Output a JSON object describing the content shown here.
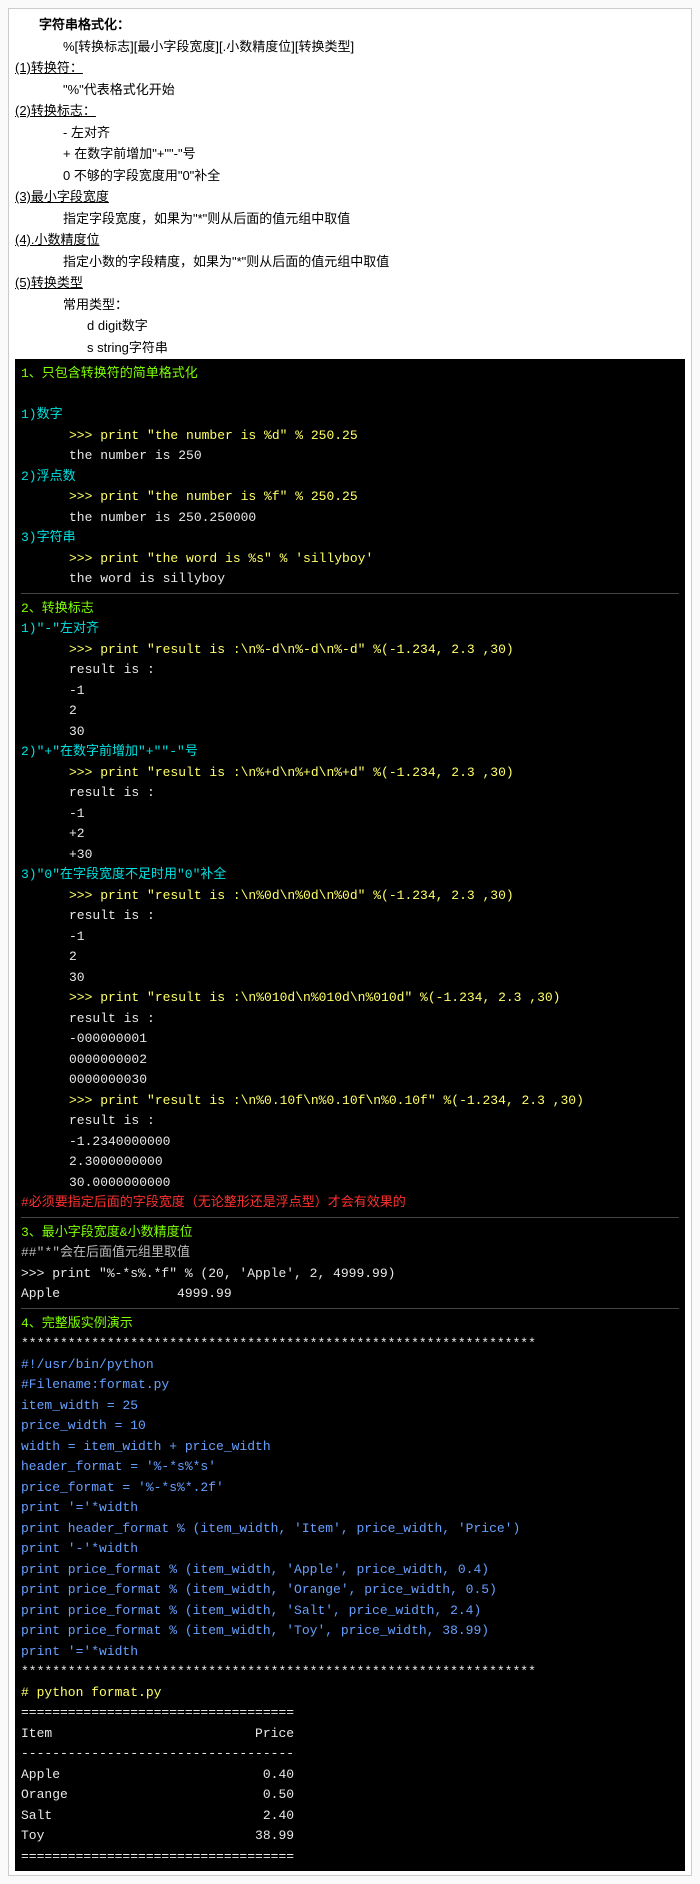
{
  "header": {
    "title": "字符串格式化：",
    "format_syntax": "%[转换标志][最小字段宽度][.小数精度位][转换类型]",
    "s1_title": "(1)转换符：",
    "s1_line1": "\"%\"代表格式化开始",
    "s2_title": "(2)转换标志：",
    "s2_line1": "- 左对齐",
    "s2_line2": "+ 在数字前增加\"+\"\"-\"号",
    "s2_line3": "0 不够的字段宽度用\"0\"补全",
    "s3_title": "(3)最小字段宽度",
    "s3_line1": "指定字段宽度，如果为\"*\"则从后面的值元组中取值",
    "s4_title": "(4).小数精度位",
    "s4_line1": "指定小数的字段精度，如果为\"*\"则从后面的值元组中取值",
    "s5_title": "(5)转换类型",
    "s5_line1": "常用类型：",
    "s5_line2": "d digit数字",
    "s5_line3": "s string字符串"
  },
  "block1": {
    "title": "1、只包含转换符的简单格式化",
    "sub1": "1)数字",
    "sub1_cmd": ">>> print \"the number is %d\" % 250.25",
    "sub1_out": "the number is 250",
    "sub2": "2)浮点数",
    "sub2_cmd": ">>> print \"the number is %f\" % 250.25",
    "sub2_out": "the number is 250.250000",
    "sub3": "3)字符串",
    "sub3_cmd": ">>> print \"the word is %s\" % 'sillyboy'",
    "sub3_out": "the word is sillyboy"
  },
  "block2": {
    "title": "2、转换标志",
    "sub1": "1)\"-\"左对齐",
    "sub1_cmd": ">>> print \"result is :\\n%-d\\n%-d\\n%-d\" %(-1.234, 2.3 ,30)",
    "sub1_out1": "result is :",
    "sub1_out2": "-1",
    "sub1_out3": "2",
    "sub1_out4": "30",
    "sub2": "2)\"+\"在数字前增加\"+\"\"-\"号",
    "sub2_cmd": ">>> print \"result is :\\n%+d\\n%+d\\n%+d\" %(-1.234, 2.3 ,30)",
    "sub2_out1": "result is :",
    "sub2_out2": "-1",
    "sub2_out3": "+2",
    "sub2_out4": "+30",
    "sub3": "3)\"0\"在字段宽度不足时用\"0\"补全",
    "sub3_cmd1": ">>> print \"result is :\\n%0d\\n%0d\\n%0d\" %(-1.234, 2.3 ,30)",
    "sub3_out1": "result is :",
    "sub3_out2": "-1",
    "sub3_out3": "2",
    "sub3_out4": "30",
    "sub3_cmd2": ">>> print \"result is :\\n%010d\\n%010d\\n%010d\" %(-1.234, 2.3 ,30)",
    "sub3_out5": "result is :",
    "sub3_out6": "-000000001",
    "sub3_out7": "0000000002",
    "sub3_out8": "0000000030",
    "sub3_cmd3": ">>> print \"result is :\\n%0.10f\\n%0.10f\\n%0.10f\" %(-1.234, 2.3 ,30)",
    "sub3_out9": "result is :",
    "sub3_out10": "-1.2340000000",
    "sub3_out11": "2.3000000000",
    "sub3_out12": "30.0000000000",
    "warning": "#必须要指定后面的字段宽度（无论整形还是浮点型）才会有效果的"
  },
  "block3": {
    "title": "3、最小字段宽度&小数精度位",
    "note": "##\"*\"会在后面值元组里取值",
    "cmd": ">>> print \"%-*s%.*f\" % (20, 'Apple', 2, 4999.99)",
    "out": "Apple               4999.99"
  },
  "block4": {
    "title": "4、完整版实例演示",
    "divider": "******************************************************************",
    "c1": "#!/usr/bin/python",
    "c2": "#Filename:format.py",
    "c3": "",
    "c4": "item_width = 25",
    "c5": "price_width = 10",
    "c6": "width = item_width + price_width",
    "c7": "",
    "c8": "header_format = '%-*s%*s'",
    "c9": "price_format = '%-*s%*.2f'",
    "c10": "",
    "c11": "print '='*width",
    "c12": "print header_format % (item_width, 'Item', price_width, 'Price')",
    "c13": "print '-'*width",
    "c14": "print price_format % (item_width, 'Apple', price_width, 0.4)",
    "c15": "print price_format % (item_width, 'Orange', price_width, 0.5)",
    "c16": "print price_format % (item_width, 'Salt', price_width, 2.4)",
    "c17": "print price_format % (item_width, 'Toy', price_width, 38.99)",
    "c18": "print '='*width",
    "run": "# python format.py",
    "o1": "===================================",
    "o2": "Item                          Price",
    "o3": "-----------------------------------",
    "o4": "Apple                          0.40",
    "o5": "Orange                         0.50",
    "o6": "Salt                           2.40",
    "o7": "Toy                           38.99",
    "o8": "==================================="
  }
}
